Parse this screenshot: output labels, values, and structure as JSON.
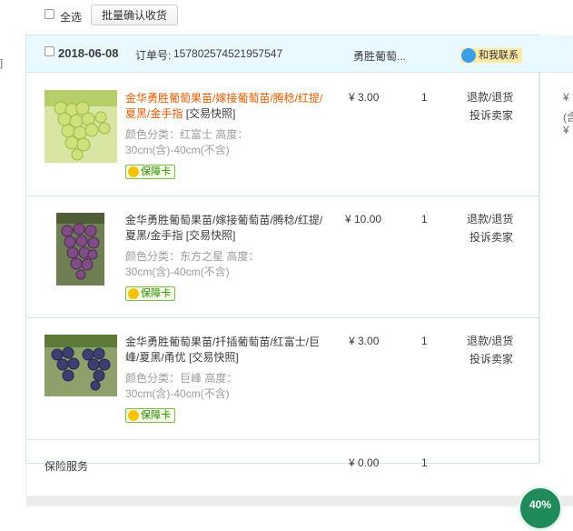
{
  "toolbar": {
    "select_all_label": "全选",
    "batch_confirm_label": "批量确认收货"
  },
  "left": {
    "fragment": "]"
  },
  "order": {
    "date": "2018-06-08",
    "order_no_label": "订单号:",
    "order_no": "157802574521957547",
    "shop_name": "勇胜葡萄...",
    "contact_label": "和我联系",
    "items": [
      {
        "title": "金华勇胜葡萄果苗/嫁接葡萄苗/腾稔/红提/夏黑/金手指",
        "snapshot": "[交易快照]",
        "sku": "颜色分类：红富士  高度：30cm(含)-40cm(不含)",
        "badge": "保障卡",
        "price": "¥ 3.00",
        "qty": "1",
        "op1": "退款/退货",
        "op2": "投诉卖家",
        "image": "green-grapes"
      },
      {
        "title": "金华勇胜葡萄果苗/嫁接葡萄苗/腾稔/红提/夏黑/金手指",
        "snapshot": "[交易快照]",
        "sku": "颜色分类：东方之星  高度：30cm(含)-40cm(不含)",
        "badge": "保障卡",
        "price": "¥ 10.00",
        "qty": "1",
        "op1": "退款/退货",
        "op2": "投诉卖家",
        "image": "purple-grapes"
      },
      {
        "title": "金华勇胜葡萄果苗/扦插葡萄苗/红富士/巨峰/夏黑/甬优",
        "snapshot": "[交易快照]",
        "sku": "颜色分类：巨峰  高度：30cm(含)-40cm(不含)",
        "badge": "保障卡",
        "price": "¥ 3.00",
        "qty": "1",
        "op1": "退款/退货",
        "op2": "投诉卖家",
        "image": "dark-grapes"
      }
    ],
    "insurance": {
      "label": "保险服务",
      "price": "¥ 0.00",
      "qty": "1"
    }
  },
  "right": {
    "frag1": "¥",
    "frag2": "(含",
    "frag3": "¥"
  },
  "progress": {
    "label": "40%"
  },
  "colors": {
    "header_bg": "#eaf8ff",
    "border": "#d2e7f6",
    "highlight_title": "#e45b00",
    "badge_green": "#2e8b00",
    "contact_bg": "#ffe9a6"
  }
}
